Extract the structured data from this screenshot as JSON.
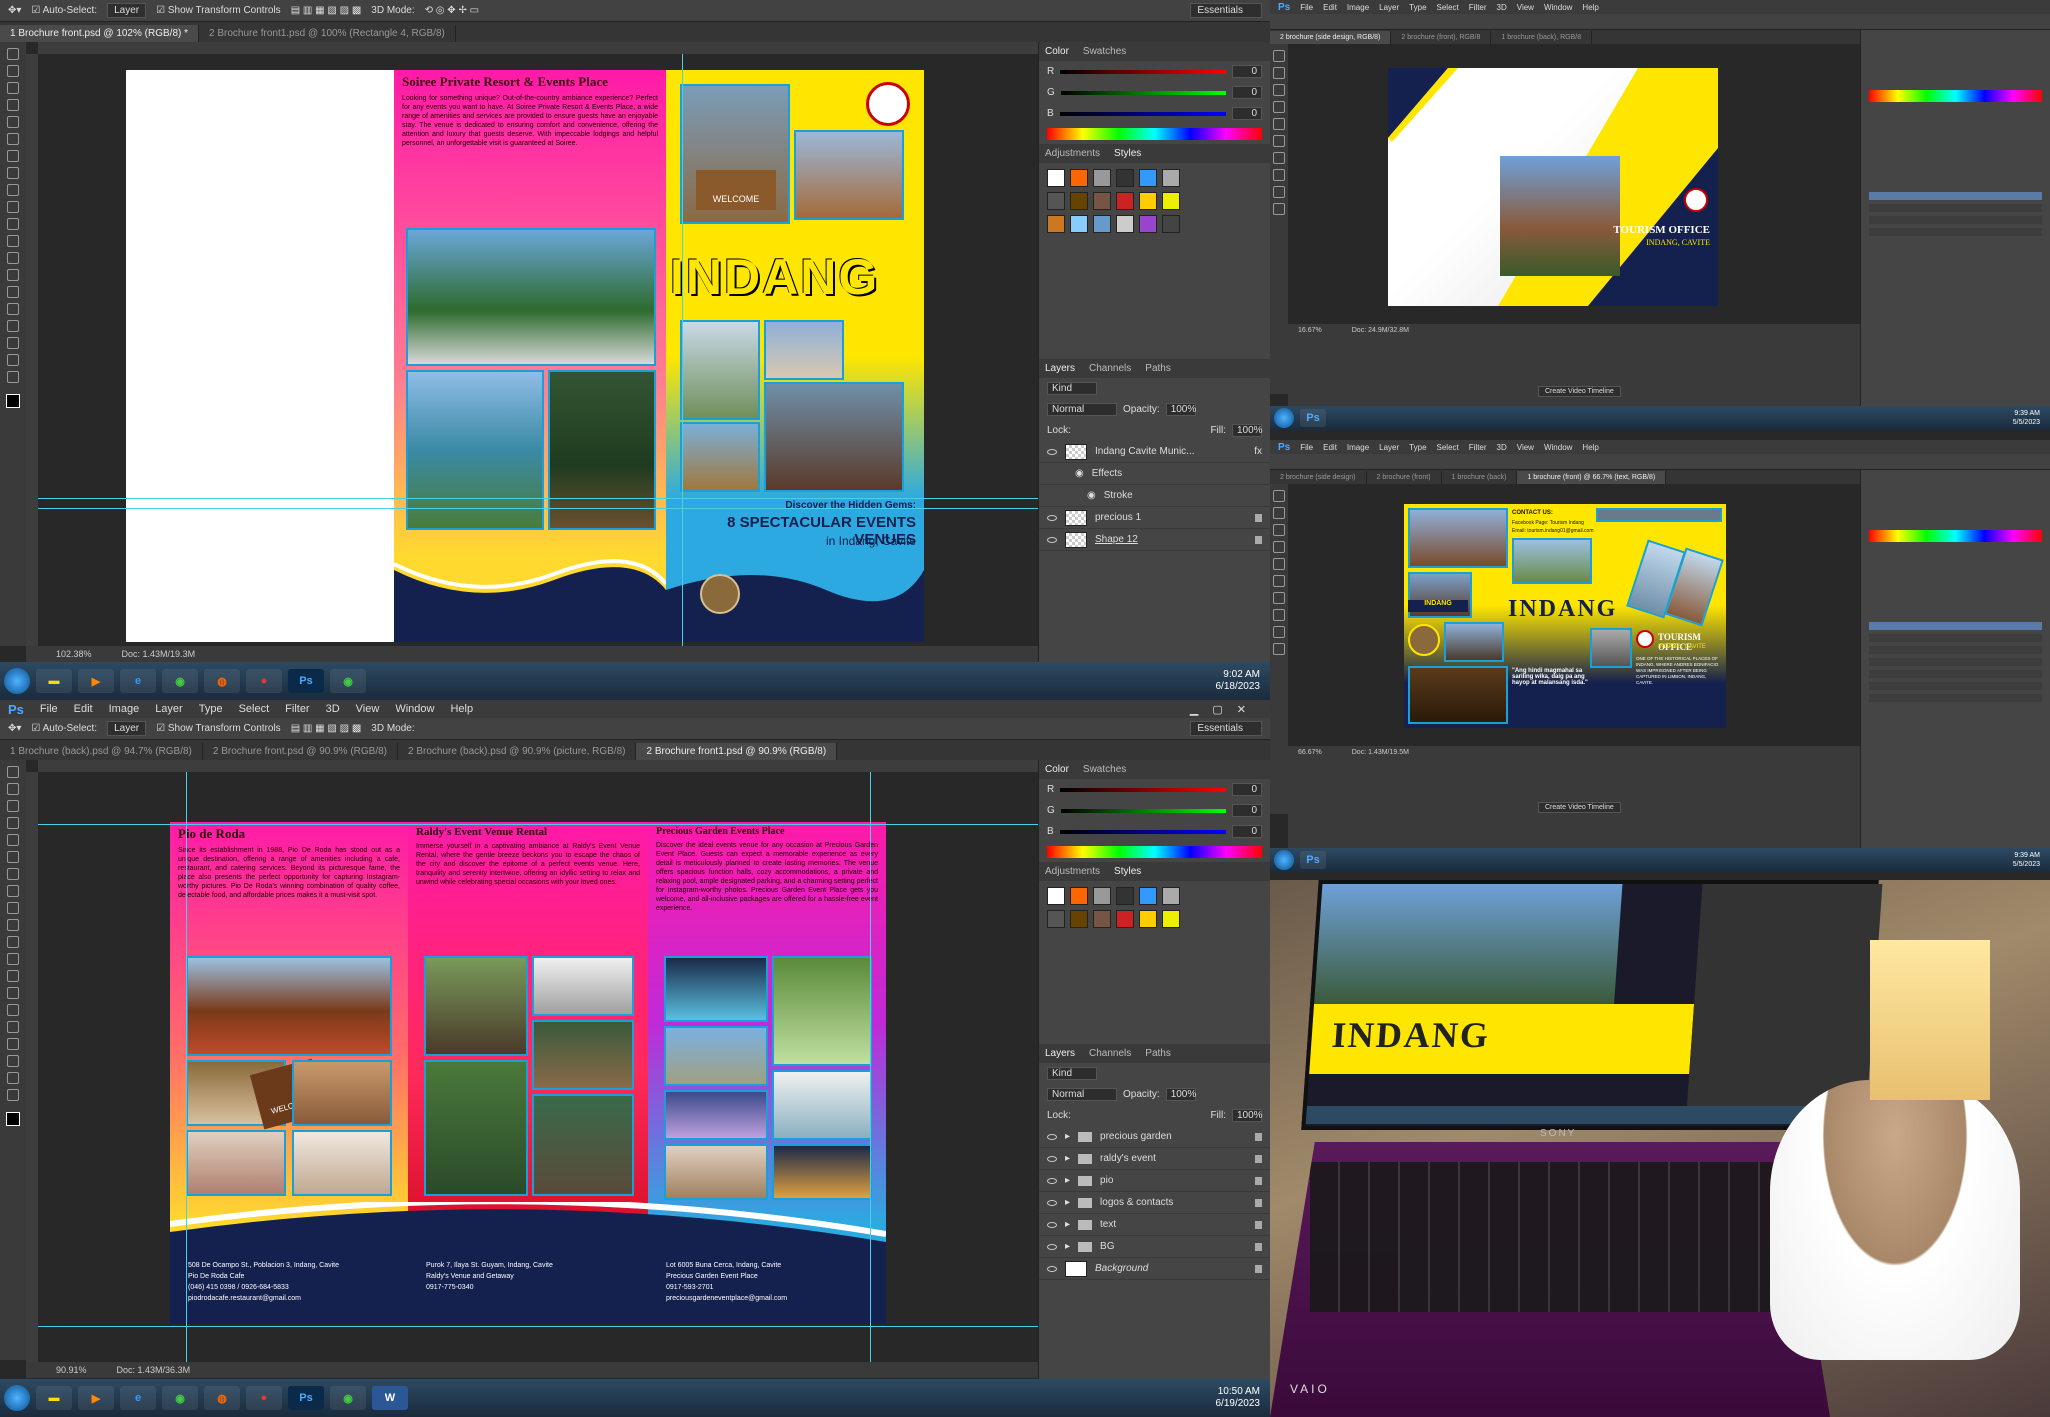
{
  "app": {
    "logo": "Ps",
    "menus": [
      "File",
      "Edit",
      "Image",
      "Layer",
      "Type",
      "Select",
      "Filter",
      "3D",
      "View",
      "Window",
      "Help"
    ]
  },
  "options": {
    "auto_select": "Auto-Select:",
    "layer_select": "Layer",
    "transform": "Show Transform Controls",
    "mode3d": "3D Mode:",
    "workspace": "Essentials"
  },
  "win1": {
    "tabs": [
      "1 Brochure front.psd @ 102% (RGB/8) *",
      "2 Brochure front1.psd @ 100% (Rectangle 4, RGB/8)"
    ],
    "zoom": "102.38%",
    "doc": "Doc: 1.43M/19.3M",
    "page": {
      "heading": "Soiree Private Resort & Events Place",
      "body": "Looking for something unique? Out-of-the-country ambiance experience? Perfect for any events you want to have. At Soiree Private Resort & Events Place, a wide range of amenities and services are provided to ensure guests have an enjoyable stay. The venue is dedicated to ensuring comfort and convenience, offering the attention and luxury that guests deserve. With impeccable lodgings and helpful personnel, an unforgettable visit is guaranteed at Soiree.",
      "big_title": "INDANG",
      "sign": "WELCOME",
      "tag1": "Discover the Hidden Gems:",
      "tag2": "8 SPECTACULAR EVENTS VENUES",
      "tag3": "in Indang, Cavite"
    },
    "panel": {
      "tabs": [
        "Color",
        "Swatches"
      ],
      "rgb": [
        "R",
        "G",
        "B"
      ],
      "values": [
        "0",
        "0",
        "0"
      ],
      "tabs2": [
        "Adjustments",
        "Styles"
      ],
      "tabs3": [
        "Layers",
        "Channels",
        "Paths"
      ],
      "kind": "Kind",
      "blend": "Normal",
      "opacity": "Opacity:",
      "opacity_val": "100%",
      "lock": "Lock:",
      "fill": "Fill:",
      "fill_val": "100%",
      "layers": [
        "Indang Cavite Munic...",
        "Effects",
        "Stroke",
        "precious 1",
        "Shape 12"
      ]
    },
    "clock": {
      "time": "9:02 AM",
      "date": "6/18/2023"
    }
  },
  "win2": {
    "menus": [
      "File",
      "Edit",
      "Image",
      "Layer",
      "Type",
      "Select",
      "Filter",
      "3D",
      "View",
      "Window",
      "Help"
    ],
    "tabs": [
      "2 brochure (side design, RGB/8)",
      "2 brochure (front), RGB/8",
      "1 brochure (back), RGB/8"
    ],
    "office": "TOURISM OFFICE",
    "place": "INDANG, CAVITE",
    "zoom": "16.67%",
    "doc": "Doc: 24.9M/32.8M",
    "timeline": "Create Video Timeline",
    "clock": {
      "time": "9:39 AM",
      "date": "5/5/2023"
    }
  },
  "win3": {
    "tabs": [
      "2 brochure (side design)",
      "2 brochure (front)",
      "1 brochure (back)",
      "1 brochure (front) @ 66.7% (text, RGB/8)"
    ],
    "contact": "CONTACT US:",
    "fb": "Facebook Page: Tourism Indang",
    "email": "Email: tourism.indang01@gmail.com",
    "big": "INDANG",
    "office": "TOURISM OFFICE",
    "place": "INDANG, CAVITE",
    "quote": "\"Ang hindi magmahal sa sariling wika, daig pa ang hayop at malansang isda.\"",
    "history": "ONE OF THE HISTORICAL PLACES OF INDANG, WHERE ANDRES BONIFACIO WAS IMPRISONED AFTER BEING CAPTURED IN LIMBON, INDANG, CAVITE.",
    "zoom": "66.67%",
    "doc": "Doc: 1.43M/19.5M",
    "timeline": "Create Video Timeline",
    "clock": {
      "time": "9:39 AM",
      "date": "5/5/2023"
    }
  },
  "win4": {
    "tabs": [
      "1 Brochure (back).psd @ 94.7% (RGB/8)",
      "2 Brochure front.psd @ 90.9% (RGB/8)",
      "2 Brochure (back).psd @ 90.9% (picture, RGB/8)",
      "2 Brochure front1.psd @ 90.9% (RGB/8)"
    ],
    "cols": [
      {
        "title": "Pio de Roda",
        "body": "Since its establishment in 1988, Pio De Roda has stood out as a unique destination, offering a range of amenities including a cafe, restaurant, and catering services. Beyond its picturesque fame, the place also presents the perfect opportunity for capturing Instagram-worthy pictures. Pio De Roda's winning combination of quality coffee, delectable food, and affordable prices makes it a must-visit spot.",
        "contacts": [
          "508 De Ocampo St., Poblacion 3, Indang, Cavite",
          "Pio De Roda Cafe",
          "(046) 415 0398 / 0926-684-5833",
          "piodrodacafe.restaurant@gmail.com"
        ]
      },
      {
        "title": "Raldy's Event Venue Rental",
        "body": "Immerse yourself in a captivating ambiance at Raldy's Event Venue Rental, where the gentle breeze beckons you to escape the chaos of the city and discover the epitome of a perfect events venue. Here, tranquility and serenity intertwine, offering an idyllic setting to relax and unwind while celebrating special occasions with your loved ones.",
        "contacts": [
          "Purok 7, Ilaya St. Guyam, Indang, Cavite",
          "Raldy's Venue and Getaway",
          "0917-775-0340"
        ]
      },
      {
        "title": "Precious Garden Events Place",
        "body": "Discover the ideal events venue for any occasion at Precious Garden Event Place. Guests can expect a memorable experience as every detail is meticulously planned to create lasting memories. The venue offers spacious function halls, cozy accommodations, a private and relaxing pool, ample designated parking, and a charming setting perfect for Instagram-worthy photos. Precious Garden Event Place gets you welcome, and all-inclusive packages are offered for a hassle-free event experience.",
        "contacts": [
          "Lot 6005 Buna Cerca, Indang, Cavite",
          "Precious Garden Event Place",
          "0917-593-2701",
          "preciousgardeneventplace@gmail.com"
        ]
      }
    ],
    "sign": "WELCOME",
    "panel": {
      "layers": [
        "precious garden",
        "raldy's event",
        "pio",
        "logos & contacts",
        "text",
        "BG",
        "Background"
      ]
    },
    "zoom": "90.91%",
    "doc": "Doc: 1.43M/36.3M",
    "clock": {
      "time": "10:50 AM",
      "date": "6/19/2023"
    }
  },
  "photo": {
    "big": "INDANG",
    "brand": "SONY",
    "vaio": "VAIO"
  },
  "colors": {
    "magenta": "#ff1aa8",
    "yellow": "#ffe600",
    "navy": "#14204e",
    "cyan": "#1a9fd8",
    "ps_blue": "#4ea9ff"
  }
}
